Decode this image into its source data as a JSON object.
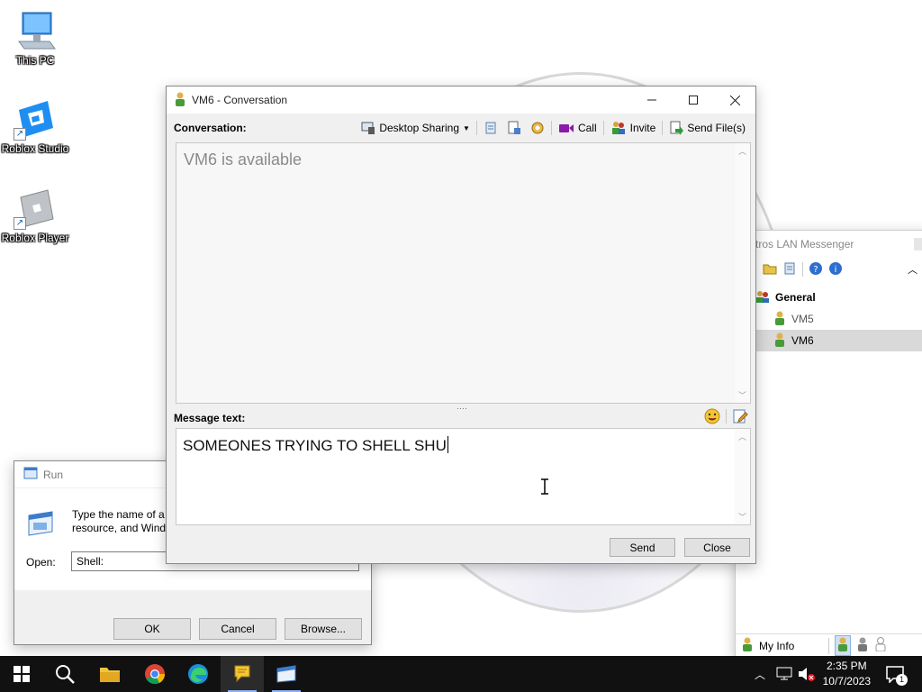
{
  "desktop": {
    "icons": [
      {
        "label": "This PC"
      },
      {
        "label": "Roblox Studio"
      },
      {
        "label": "Roblox Player"
      }
    ]
  },
  "run_dialog": {
    "title": "Run",
    "description_line1": "Type the name of a p",
    "description_line2": "resource, and Windo",
    "open_label": "Open:",
    "open_value": "Shell:",
    "ok_label": "OK",
    "cancel_label": "Cancel",
    "browse_label": "Browse..."
  },
  "messenger": {
    "title": "tros LAN Messenger",
    "group": "General",
    "contacts": [
      {
        "name": "VM5"
      },
      {
        "name": "VM6"
      }
    ],
    "my_info_label": "My Info"
  },
  "conversation": {
    "title": "VM6 - Conversation",
    "conversation_label": "Conversation:",
    "toolbar": {
      "desktop_sharing": "Desktop Sharing",
      "call": "Call",
      "invite": "Invite",
      "send_files": "Send File(s)"
    },
    "status_message": "VM6 is available",
    "message_label": "Message text:",
    "message_value": "SOMEONES TRYING TO SHELL SHU",
    "send_label": "Send",
    "close_label": "Close"
  },
  "taskbar": {
    "time": "2:35 PM",
    "date": "10/7/2023",
    "notification_count": "1"
  },
  "colors": {
    "taskbar_bg": "#111111",
    "window_bg": "#f0f0f0",
    "accent": "#0078d7"
  }
}
